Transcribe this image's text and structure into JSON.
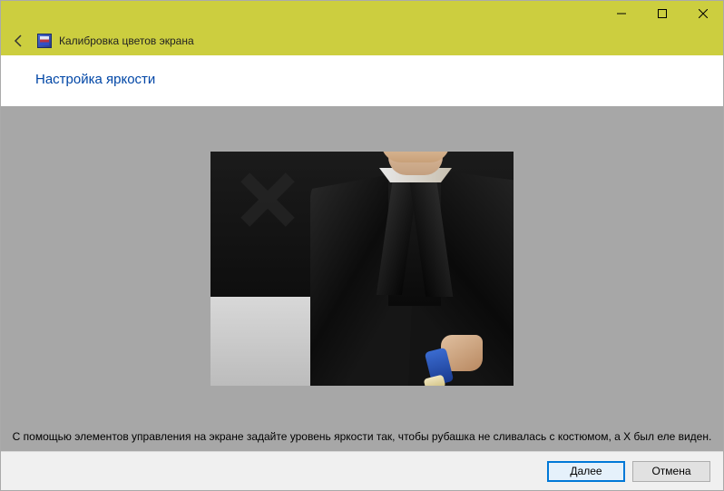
{
  "window": {
    "app_title": "Калибровка цветов экрана"
  },
  "page": {
    "heading": "Настройка яркости",
    "instruction": "С помощью элементов управления на экране задайте уровень яркости так, чтобы рубашка не сливалась с костюмом, а X был еле виден."
  },
  "buttons": {
    "next": "Далее",
    "cancel": "Отмена"
  }
}
